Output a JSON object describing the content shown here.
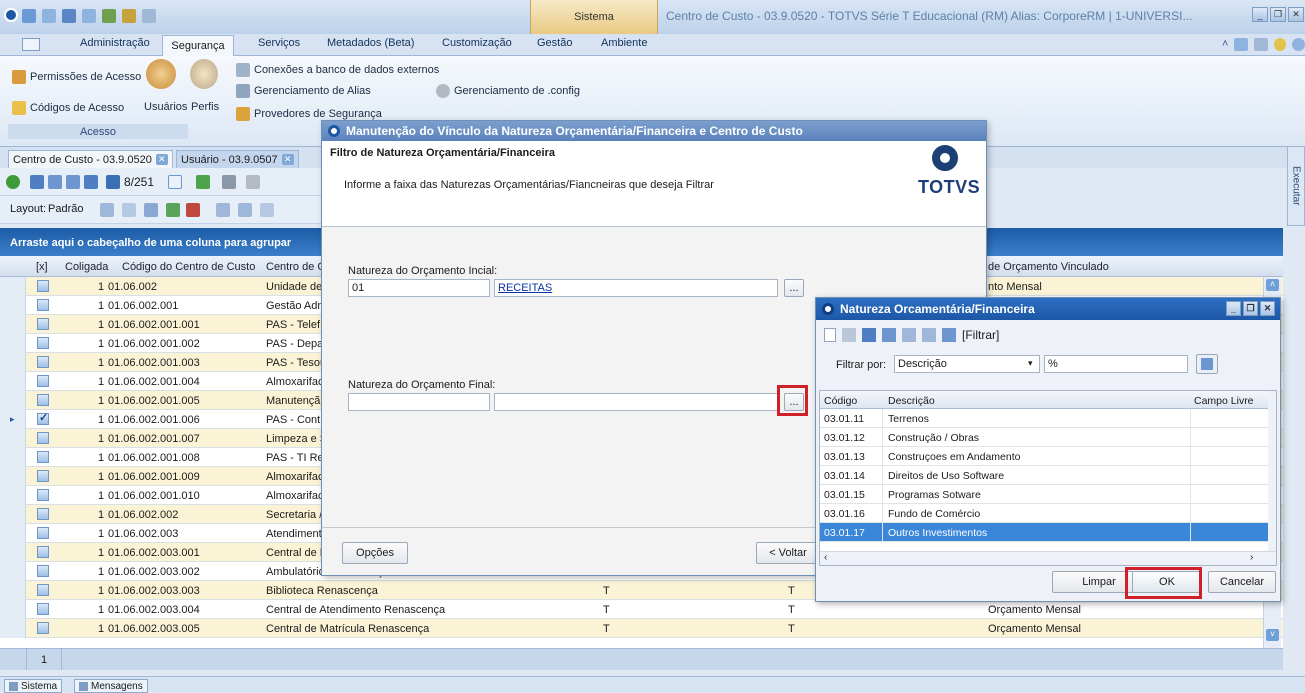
{
  "window": {
    "title": "Centro de Custo  - 03.9.0520 - TOTVS Série T Educacional (RM) Alias: CorporeRM | 1-UNIVERSI...",
    "sistema_tab": "Sistema"
  },
  "menu": {
    "items": [
      "Administração",
      "Segurança",
      "Serviços",
      "Metadados (Beta)",
      "Customização",
      "Gestão",
      "Ambiente"
    ]
  },
  "ribbon": {
    "permissoes": "Permissões de Acesso",
    "codigos": "Códigos de Acesso",
    "usuarios": "Usuários",
    "perfis": "Perfis",
    "conexoes": "Conexões a banco de dados externos",
    "alias": "Gerenciamento de Alias",
    "config": "Gerenciamento de .config",
    "provedores": "Provedores de Segurança",
    "group_label": "Acesso"
  },
  "doc_tabs": [
    "Centro de Custo  - 03.9.0520",
    "Usuário - 03.9.0507"
  ],
  "toolbar": {
    "record_count": "8/251",
    "layout_label": "Layout:",
    "layout_value": "Padrão"
  },
  "grid": {
    "group_hint": "Arraste aqui o cabeçalho de uma coluna para agrupar",
    "headers": {
      "check": "[x]",
      "coligada": "Coligada",
      "codigo": "Código do Centro de Custo",
      "centro": "Centro de C",
      "orcamento": "de Orçamento Vinculado"
    },
    "rows": [
      {
        "coligada": "1",
        "codigo": "01.06.002",
        "nome": "Unidade de",
        "c1": "",
        "c2": "",
        "orc": "nto Mensal",
        "checked": false
      },
      {
        "coligada": "1",
        "codigo": "01.06.002.001",
        "nome": "Gestão Adm",
        "c1": "",
        "c2": "",
        "orc": "",
        "checked": false
      },
      {
        "coligada": "1",
        "codigo": "01.06.002.001.001",
        "nome": "PAS  - Telef",
        "c1": "",
        "c2": "",
        "orc": "",
        "checked": false
      },
      {
        "coligada": "1",
        "codigo": "01.06.002.001.002",
        "nome": "PAS  - Depa",
        "c1": "",
        "c2": "",
        "orc": "",
        "checked": false
      },
      {
        "coligada": "1",
        "codigo": "01.06.002.001.003",
        "nome": "PAS - Tesou",
        "c1": "",
        "c2": "",
        "orc": "",
        "checked": false
      },
      {
        "coligada": "1",
        "codigo": "01.06.002.001.004",
        "nome": "Almoxarifac",
        "c1": "",
        "c2": "",
        "orc": "",
        "checked": false
      },
      {
        "coligada": "1",
        "codigo": "01.06.002.001.005",
        "nome": "Manutençã",
        "c1": "",
        "c2": "",
        "orc": "",
        "checked": false
      },
      {
        "coligada": "1",
        "codigo": "01.06.002.001.006",
        "nome": "PAS - Contr",
        "c1": "",
        "c2": "",
        "orc": "",
        "checked": true
      },
      {
        "coligada": "1",
        "codigo": "01.06.002.001.007",
        "nome": "Limpeza e S",
        "c1": "",
        "c2": "",
        "orc": "",
        "checked": false
      },
      {
        "coligada": "1",
        "codigo": "01.06.002.001.008",
        "nome": "PAS - TI Re",
        "c1": "",
        "c2": "",
        "orc": "",
        "checked": false
      },
      {
        "coligada": "1",
        "codigo": "01.06.002.001.009",
        "nome": "Almoxarifac",
        "c1": "",
        "c2": "",
        "orc": "",
        "checked": false
      },
      {
        "coligada": "1",
        "codigo": "01.06.002.001.010",
        "nome": "Almoxarifac",
        "c1": "",
        "c2": "",
        "orc": "",
        "checked": false
      },
      {
        "coligada": "1",
        "codigo": "01.06.002.002",
        "nome": "Secretaria /",
        "c1": "",
        "c2": "",
        "orc": "",
        "checked": false
      },
      {
        "coligada": "1",
        "codigo": "01.06.002.003",
        "nome": "Atendiment",
        "c1": "",
        "c2": "",
        "orc": "",
        "checked": false
      },
      {
        "coligada": "1",
        "codigo": "01.06.002.003.001",
        "nome": "Central de E",
        "c1": "",
        "c2": "",
        "orc": "",
        "checked": false
      },
      {
        "coligada": "1",
        "codigo": "01.06.002.003.002",
        "nome": "Ambulatório Renascença",
        "c1": "T",
        "c2": "T",
        "orc": "Orçamento Mensal",
        "checked": false
      },
      {
        "coligada": "1",
        "codigo": "01.06.002.003.003",
        "nome": "Biblioteca Renascença",
        "c1": "T",
        "c2": "T",
        "orc": "Orçamento Mensal",
        "checked": false
      },
      {
        "coligada": "1",
        "codigo": "01.06.002.003.004",
        "nome": "Central de Atendimento Renascença",
        "c1": "T",
        "c2": "T",
        "orc": "Orçamento Mensal",
        "checked": false
      },
      {
        "coligada": "1",
        "codigo": "01.06.002.003.005",
        "nome": "Central de Matrícula Renascença",
        "c1": "T",
        "c2": "T",
        "orc": "Orçamento Mensal",
        "checked": false
      }
    ],
    "footer_count": "1"
  },
  "dialog_main": {
    "title": "Manutenção do Vínculo da Natureza Orçamentária/Financeira e Centro de Custo",
    "heading": "Filtro de Natureza Orçamentária/Financeira",
    "description": "Informe a faixa das Naturezas Orçamentárias/Fiancneiras que deseja Filtrar",
    "logo": "TOTVS",
    "inicial_label": "Natureza do Orçamento Incial:",
    "inicial_code": "01",
    "inicial_desc": "RECEITAS",
    "final_label": "Natureza do Orçamento Final:",
    "final_code": "",
    "final_desc": "",
    "lookup_btn": "...",
    "opcoes_btn": "Opções",
    "voltar_btn": "< Voltar"
  },
  "dialog_lookup": {
    "title": "Natureza Orcamentária/Financeira",
    "filtrar_menu": "[Filtrar]",
    "filtrar_por_label": "Filtrar por:",
    "filtrar_por_value": "Descrição",
    "filter_value": "%",
    "headers": {
      "codigo": "Código",
      "descricao": "Descrição",
      "campo": "Campo Livre"
    },
    "rows": [
      {
        "codigo": "03.01.11",
        "descricao": "Terrenos"
      },
      {
        "codigo": "03.01.12",
        "descricao": "Construção / Obras"
      },
      {
        "codigo": "03.01.13",
        "descricao": "Construçoes em Andamento"
      },
      {
        "codigo": "03.01.14",
        "descricao": "Direitos de Uso Software"
      },
      {
        "codigo": "03.01.15",
        "descricao": "Programas Sotware"
      },
      {
        "codigo": "03.01.16",
        "descricao": "Fundo de Comércio"
      },
      {
        "codigo": "03.01.17",
        "descricao": "Outros Investimentos"
      }
    ],
    "selected_index": 6,
    "limpar_btn": "Limpar",
    "ok_btn": "OK",
    "cancelar_btn": "Cancelar"
  },
  "status_tabs": [
    "Sistema",
    "Mensagens"
  ],
  "side_panel": "Executar",
  "colors": {
    "accent": "#1c5ca6",
    "highlight_row": "#fbf3d6",
    "selection": "#3a86d9",
    "callout": "#d0202a"
  }
}
